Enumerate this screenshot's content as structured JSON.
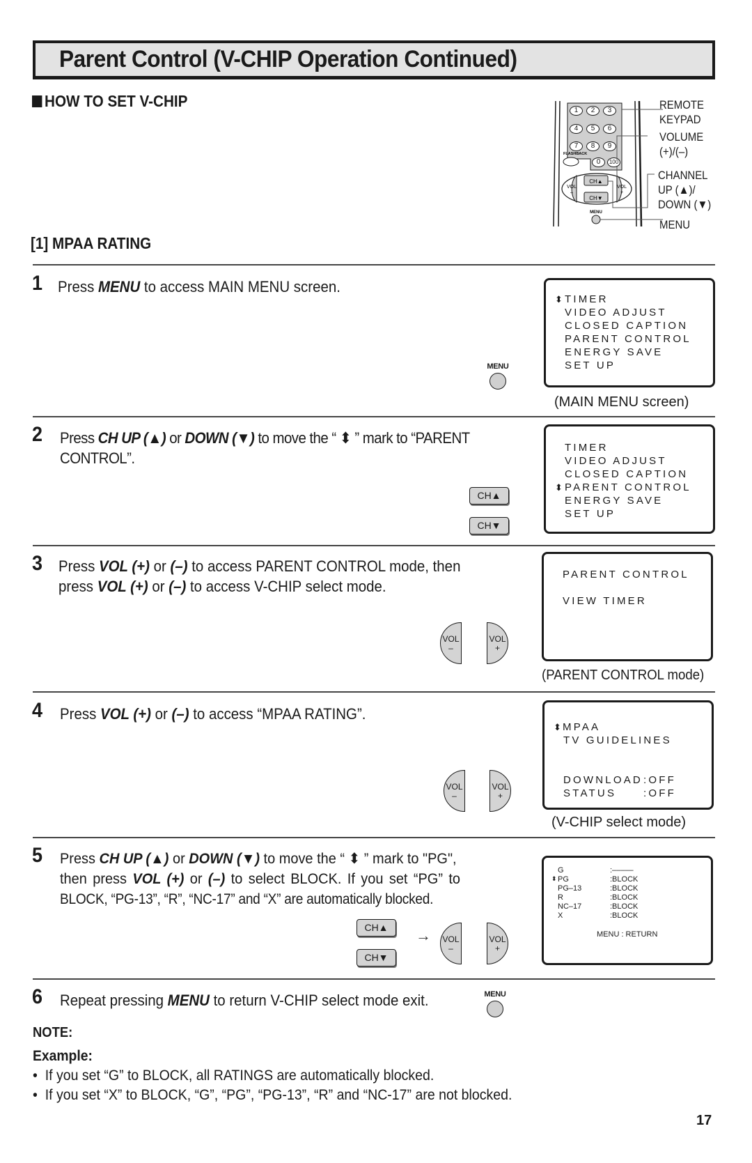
{
  "title": "Parent Control (V-CHIP Operation Continued)",
  "section_heading": "HOW TO SET V-CHIP",
  "subsection_heading": "[1] MPAA RATING",
  "remote": {
    "keys": [
      "1",
      "2",
      "3",
      "4",
      "5",
      "6",
      "7",
      "8",
      "9",
      "0",
      "100"
    ],
    "flashback_label": "FLASHBACK",
    "vol_label": "VOL",
    "ch_up_label": "CH▲",
    "ch_down_label": "CH▼",
    "menu_label": "MENU",
    "callouts": [
      {
        "line1": "REMOTE",
        "line2": "KEYPAD"
      },
      {
        "line1": "VOLUME",
        "line2": "(+)/(–)"
      },
      {
        "line1": "CHANNEL",
        "line2": "UP (▲)/",
        "line3": "DOWN (▼)"
      },
      {
        "line1": "MENU"
      }
    ]
  },
  "icons": {
    "select_mark": "⬍",
    "arrow_right": "→"
  },
  "buttons": {
    "menu": "MENU",
    "ch_up": "CH▲",
    "ch_down": "CH▼",
    "vol": "VOL",
    "minus": "–",
    "plus": "+"
  },
  "steps": [
    {
      "number": "1",
      "pre": "Press ",
      "b1": "MENU",
      "post": " to access MAIN MENU screen.",
      "screen": {
        "marker": "⬍",
        "items": [
          "TIMER",
          "VIDEO ADJUST",
          "CLOSED CAPTION",
          "PARENT CONTROL",
          "ENERGY SAVE",
          "SET UP"
        ],
        "selected_index": 0
      },
      "caption": "(MAIN MENU screen)"
    },
    {
      "number": "2",
      "pre": "Press ",
      "b1": "CH UP (▲)",
      "mid1": " or ",
      "b2": "DOWN (▼)",
      "mid2": " to move the “ ⬍ ” mark to “PARENT",
      "line2": "CONTROL”.",
      "screen": {
        "marker": "⬍",
        "items": [
          "TIMER",
          "VIDEO ADJUST",
          "CLOSED CAPTION",
          "PARENT CONTROL",
          "ENERGY SAVE",
          "SET UP"
        ],
        "selected_index": 3
      }
    },
    {
      "number": "3",
      "pre": "Press ",
      "b1": "VOL (+)",
      "mid1": " or ",
      "b2": "(–)",
      "mid2": " to access PARENT CONTROL mode, then",
      "l2_pre": "press ",
      "l2_b1": "VOL (+)",
      "l2_mid": " or ",
      "l2_b2": "(–)",
      "l2_post": " to access V-CHIP select mode.",
      "screen": {
        "items": [
          "PARENT CONTROL",
          "VIEW TIMER"
        ]
      },
      "caption": "(PARENT CONTROL mode)"
    },
    {
      "number": "4",
      "pre": "Press ",
      "b1": "VOL (+)",
      "mid1": " or ",
      "b2": "(–)",
      "post": " to access “MPAA RATING”.",
      "screen": {
        "marker": "⬍",
        "items": [
          "MPAA",
          "TV GUIDELINES"
        ],
        "settings": [
          {
            "label": "DOWNLOAD",
            "value": ":OFF"
          },
          {
            "label": "STATUS",
            "value": ":OFF"
          }
        ]
      },
      "caption": "(V-CHIP select mode)"
    },
    {
      "number": "5",
      "pre": "Press ",
      "b1": "CH UP (▲)",
      "mid1": " or ",
      "b2": "DOWN (▼)",
      "mid2": " to move the “ ⬍ ” mark to \"PG\",",
      "l2_pre": "then press ",
      "l2_b1": "VOL (+)",
      "l2_mid": " or ",
      "l2_b2": "(–)",
      "l2_post": " to select BLOCK. If you set “PG” to",
      "line3": "BLOCK, “PG-13”, “R”, “NC-17” and “X” are automatically blocked.",
      "screen": {
        "marker": "⬍",
        "ratings": [
          {
            "rating": "G",
            "value": ":–––––"
          },
          {
            "rating": "PG",
            "value": ":BLOCK"
          },
          {
            "rating": "PG–13",
            "value": ":BLOCK"
          },
          {
            "rating": "R",
            "value": ":BLOCK"
          },
          {
            "rating": "NC–17",
            "value": ":BLOCK"
          },
          {
            "rating": "X",
            "value": ":BLOCK"
          }
        ],
        "selected_index": 1,
        "footer": "MENU : RETURN"
      }
    },
    {
      "number": "6",
      "pre": "Repeat pressing ",
      "b1": "MENU",
      "post": " to return V-CHIP select mode exit."
    }
  ],
  "note": {
    "label": "NOTE:",
    "example_label": "Example:",
    "bullets": [
      "If you set “G” to BLOCK, all RATINGS are automatically blocked.",
      "If you set “X” to BLOCK, “G”, “PG”, “PG-13”, “R” and “NC-17” are not blocked."
    ]
  },
  "page_number": "17"
}
